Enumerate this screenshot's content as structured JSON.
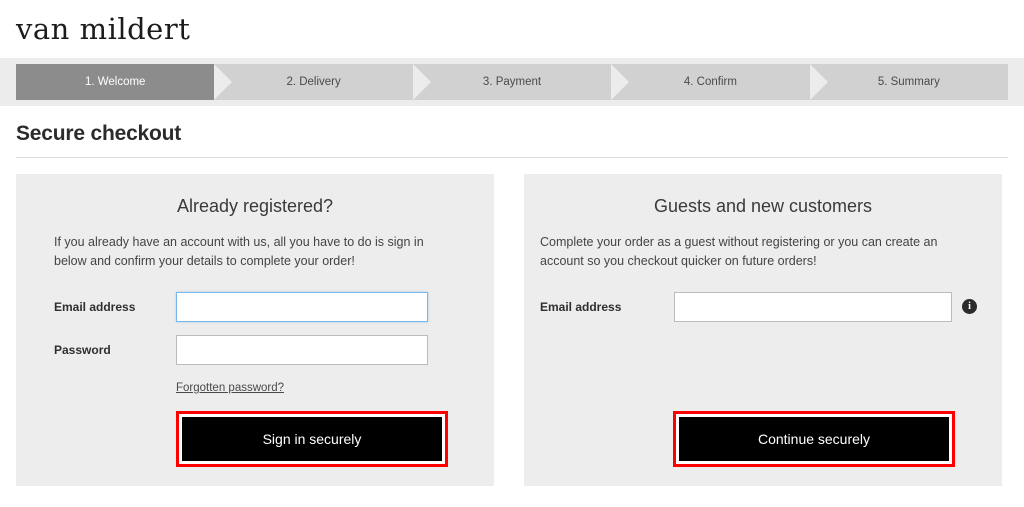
{
  "header": {
    "logo_text": "van mildert"
  },
  "steps": [
    {
      "label": "1. Welcome",
      "active": true
    },
    {
      "label": "2. Delivery",
      "active": false
    },
    {
      "label": "3. Payment",
      "active": false
    },
    {
      "label": "4. Confirm",
      "active": false
    },
    {
      "label": "5. Summary",
      "active": false
    }
  ],
  "page": {
    "title": "Secure checkout"
  },
  "login_panel": {
    "title": "Already registered?",
    "description": "If you already have an account with us, all you have to do is sign in below and confirm your details to complete your order!",
    "email_label": "Email address",
    "email_value": "",
    "email_placeholder": "",
    "password_label": "Password",
    "password_value": "",
    "password_placeholder": "",
    "forgot_link": "Forgotten password?",
    "submit_label": "Sign in securely"
  },
  "guest_panel": {
    "title": "Guests and new customers",
    "description": "Complete your order as a guest without registering or you can create an account so you checkout quicker on future orders!",
    "email_label": "Email address",
    "email_value": "",
    "email_placeholder": "",
    "info_icon": "info-icon",
    "info_glyph": "i",
    "submit_label": "Continue securely"
  },
  "colors": {
    "active_step": "#8c8c8c",
    "inactive_step": "#d1d1d1",
    "panel_bg": "#ededed",
    "button_bg": "#000000",
    "annotation": "#ff0000",
    "focus_border": "#7ab6e8"
  }
}
